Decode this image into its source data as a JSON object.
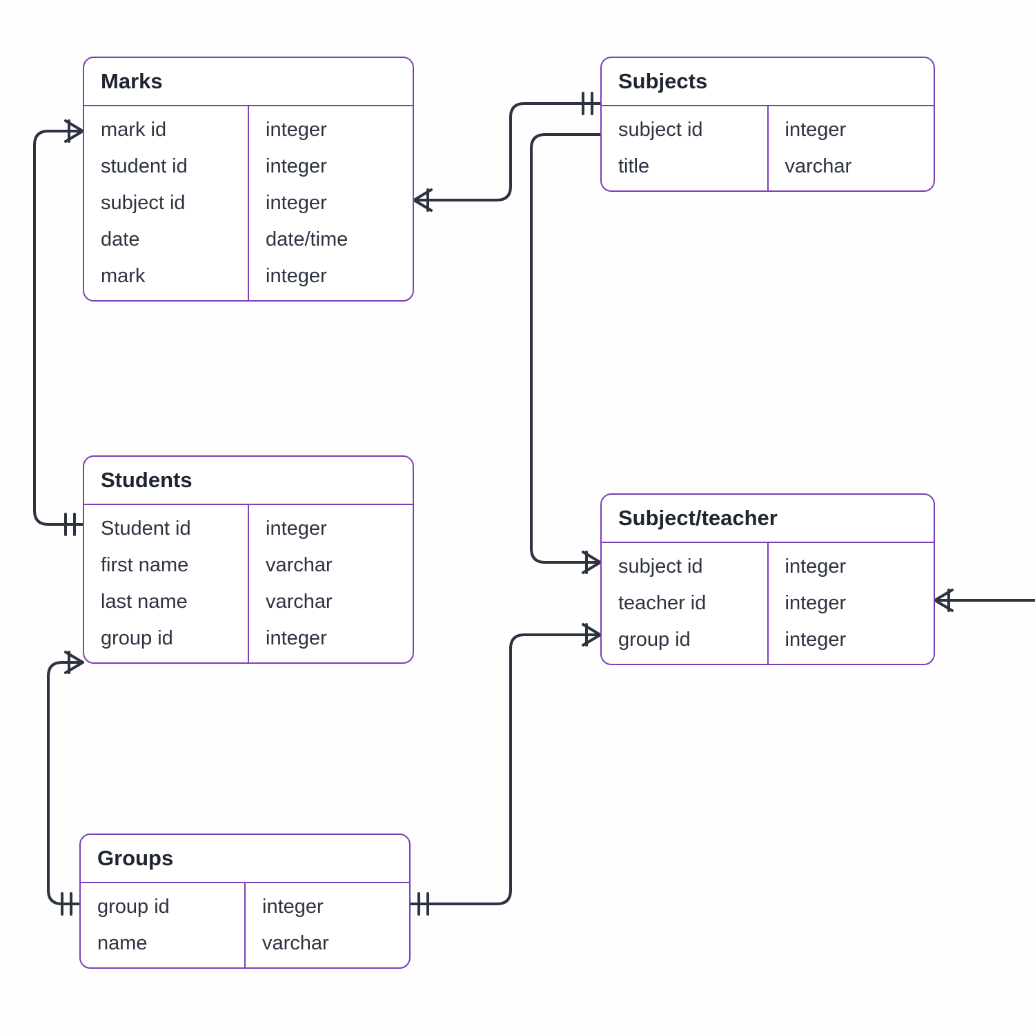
{
  "entities": {
    "marks": {
      "title": "Marks",
      "fields": [
        {
          "name": "mark id",
          "type": "integer"
        },
        {
          "name": "student id",
          "type": "integer"
        },
        {
          "name": "subject id",
          "type": "integer"
        },
        {
          "name": "date",
          "type": "date/time"
        },
        {
          "name": "mark",
          "type": "integer"
        }
      ]
    },
    "subjects": {
      "title": "Subjects",
      "fields": [
        {
          "name": "subject id",
          "type": "integer"
        },
        {
          "name": "title",
          "type": "varchar"
        }
      ]
    },
    "students": {
      "title": "Students",
      "fields": [
        {
          "name": "Student id",
          "type": "integer"
        },
        {
          "name": "first name",
          "type": "varchar"
        },
        {
          "name": "last name",
          "type": "varchar"
        },
        {
          "name": "group id",
          "type": "integer"
        }
      ]
    },
    "subject_teacher": {
      "title": "Subject/teacher",
      "fields": [
        {
          "name": "subject id",
          "type": "integer"
        },
        {
          "name": "teacher id",
          "type": "integer"
        },
        {
          "name": "group id",
          "type": "integer"
        }
      ]
    },
    "groups": {
      "title": "Groups",
      "fields": [
        {
          "name": "group id",
          "type": "integer"
        },
        {
          "name": "name",
          "type": "varchar"
        }
      ]
    }
  },
  "relationships": [
    {
      "from": "marks",
      "to": "students",
      "from_card": "many",
      "to_card": "one"
    },
    {
      "from": "marks",
      "to": "subjects",
      "from_card": "many",
      "to_card": "one"
    },
    {
      "from": "subject_teacher",
      "to": "subjects",
      "from_card": "many",
      "to_card": "one"
    },
    {
      "from": "subject_teacher",
      "to": "groups",
      "from_card": "many",
      "to_card": "one"
    },
    {
      "from": "subject_teacher",
      "to": "teachers_offscreen",
      "from_card": "many",
      "to_card": "one"
    },
    {
      "from": "students",
      "to": "groups",
      "from_card": "many",
      "to_card": "one"
    }
  ],
  "colors": {
    "entity_border": "#7b3fb8",
    "connector": "#2d3340",
    "text_heading": "#1e2530",
    "text_body": "#2d3340"
  }
}
